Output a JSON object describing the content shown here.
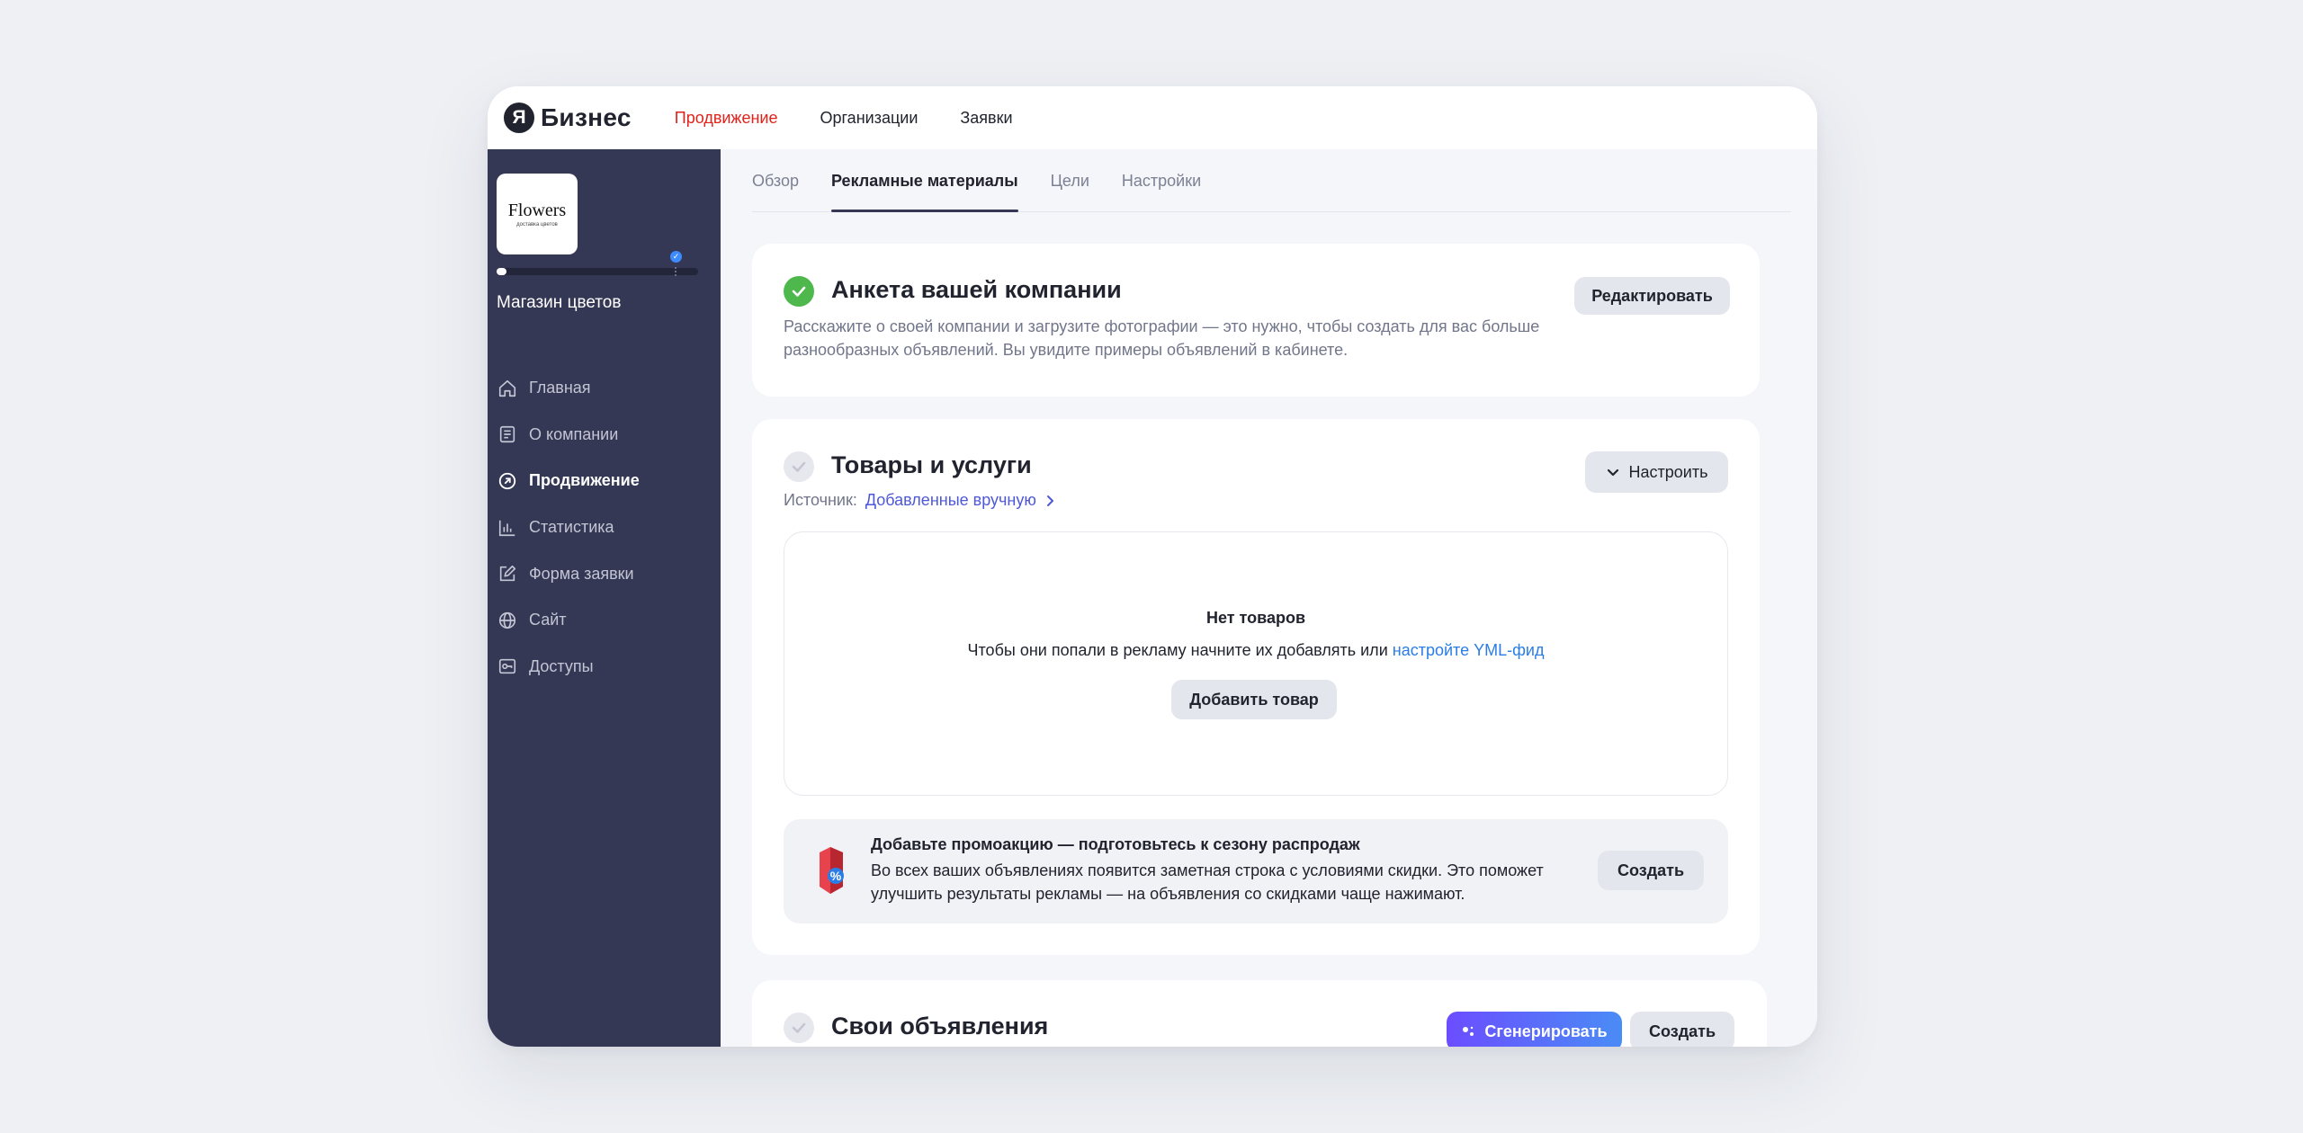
{
  "brand": {
    "logo_letter": "Я",
    "name": "Бизнес"
  },
  "topnav": [
    {
      "label": "Продвижение",
      "active": true
    },
    {
      "label": "Организации",
      "active": false
    },
    {
      "label": "Заявки",
      "active": false
    }
  ],
  "sidebar": {
    "company_logo": {
      "line1": "Flowers",
      "line2": "доставка цветов"
    },
    "profile_progress": 0.05,
    "company_name": "Магазин цветов",
    "items": [
      {
        "label": "Главная",
        "icon": "home-icon",
        "active": false
      },
      {
        "label": "О компании",
        "icon": "document-icon",
        "active": false
      },
      {
        "label": "Продвижение",
        "icon": "promotion-arrow-icon",
        "active": true
      },
      {
        "label": "Статистика",
        "icon": "bar-chart-icon",
        "active": false
      },
      {
        "label": "Форма заявки",
        "icon": "edit-form-icon",
        "active": false
      },
      {
        "label": "Сайт",
        "icon": "globe-icon",
        "active": false
      },
      {
        "label": "Доступы",
        "icon": "key-icon",
        "active": false
      }
    ]
  },
  "tabs": [
    {
      "label": "Обзор",
      "active": false
    },
    {
      "label": "Рекламные материалы",
      "active": true
    },
    {
      "label": "Цели",
      "active": false
    },
    {
      "label": "Настройки",
      "active": false
    }
  ],
  "profile_card": {
    "title": "Анкета вашей компании",
    "status": "done",
    "description_line1": "Расскажите о своей компании и загрузите фотографии — это нужно, чтобы создать для вас больше",
    "description_line2": "разнообразных объявлений. Вы увидите примеры объявлений в кабинете.",
    "edit_button": "Редактировать"
  },
  "products_card": {
    "title": "Товары и услуги",
    "status": "pending",
    "configure_button": "Настроить",
    "source_label": "Источник:",
    "source_value": "Добавленные вручную",
    "empty": {
      "title": "Нет товаров",
      "text": "Чтобы они попали в рекламу начните их добавлять или",
      "link": "настройте YML-фид",
      "add_button": "Добавить товар"
    },
    "promo": {
      "title": "Добавьте промоакцию — подготовьтесь к сезону распродаж",
      "text_line1": "Во всех ваших объявлениях появится заметная строка с условиями скидки. Это поможет",
      "text_line2": "улучшить результаты рекламы — на объявления со скидками чаще нажимают.",
      "create_button": "Создать",
      "icon": "discount-tag-icon"
    }
  },
  "ads_card": {
    "title": "Свои объявления",
    "status": "pending",
    "generate_button": "Сгенерировать",
    "create_button": "Создать"
  },
  "colors": {
    "accent_red": "#e0221a",
    "sidebar_bg": "#353855",
    "success_green": "#4fb84c",
    "link_blue": "#2a7de6",
    "generate_gradient_start": "#6b4dff",
    "generate_gradient_end": "#4a8cf6"
  }
}
